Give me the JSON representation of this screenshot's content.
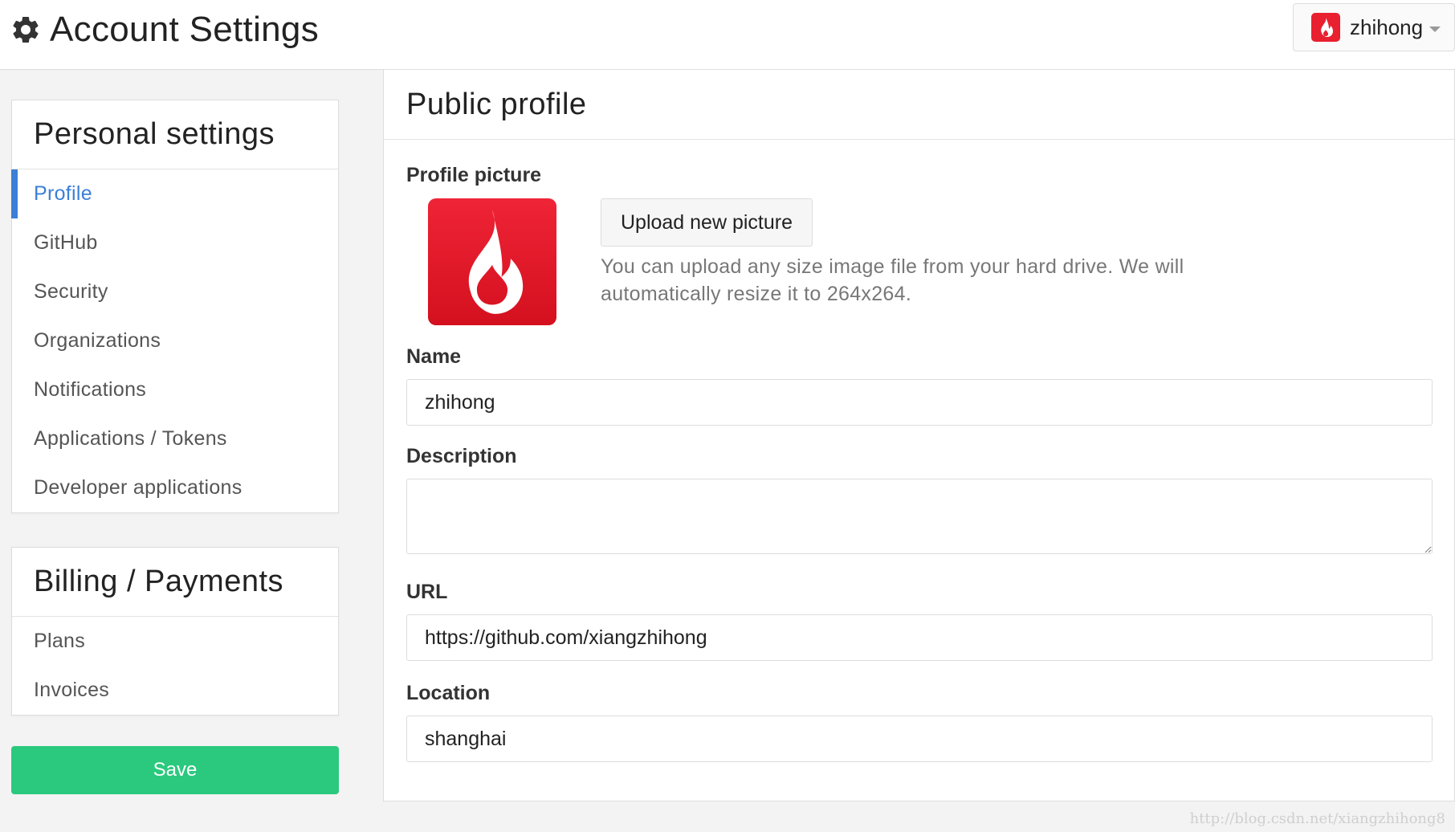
{
  "header": {
    "title": "Account Settings",
    "user": {
      "name": "zhihong",
      "avatar_color": "#e8202f"
    }
  },
  "sidebar": {
    "personal": {
      "title": "Personal settings",
      "items": [
        {
          "label": "Profile",
          "active": true
        },
        {
          "label": "GitHub"
        },
        {
          "label": "Security"
        },
        {
          "label": "Organizations"
        },
        {
          "label": "Notifications"
        },
        {
          "label": "Applications / Tokens"
        },
        {
          "label": "Developer applications"
        }
      ]
    },
    "billing": {
      "title": "Billing / Payments",
      "items": [
        {
          "label": "Plans"
        },
        {
          "label": "Invoices"
        }
      ]
    },
    "save_label": "Save"
  },
  "main": {
    "title": "Public profile",
    "picture": {
      "label": "Profile picture",
      "upload_label": "Upload new picture",
      "help": "You can upload any size image file from your hard drive. We will automatically resize it to 264x264."
    },
    "name": {
      "label": "Name",
      "value": "zhihong"
    },
    "description": {
      "label": "Description",
      "value": ""
    },
    "url": {
      "label": "URL",
      "value": "https://github.com/xiangzhihong"
    },
    "location": {
      "label": "Location",
      "value": "shanghai"
    }
  },
  "watermark": "http://blog.csdn.net/xiangzhihong8",
  "colors": {
    "accent": "#3b7fd8",
    "save": "#2ac97e",
    "brand_red": "#e8202f"
  }
}
